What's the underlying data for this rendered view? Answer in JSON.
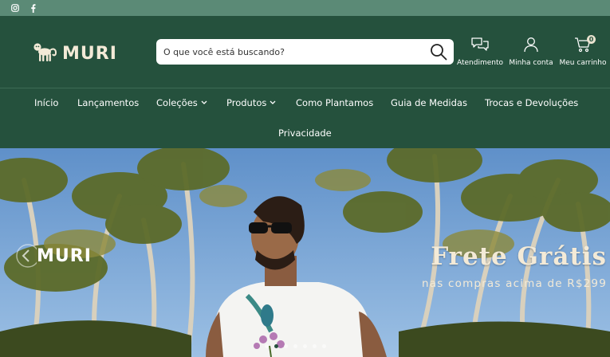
{
  "topbar": {
    "social": [
      {
        "icon": "instagram-icon"
      },
      {
        "icon": "facebook-icon"
      }
    ]
  },
  "header": {
    "logo_text": "MURI",
    "search": {
      "placeholder": "O que você está buscando?",
      "value": ""
    },
    "actions": [
      {
        "label": "Atendimento",
        "icon": "chat-icon"
      },
      {
        "label": "Minha conta",
        "icon": "user-icon"
      },
      {
        "label": "Meu carrinho",
        "icon": "cart-icon",
        "badge": "0"
      }
    ]
  },
  "nav": {
    "items": [
      {
        "label": "Início"
      },
      {
        "label": "Lançamentos"
      },
      {
        "label": "Coleções"
      },
      {
        "label": "Produtos"
      },
      {
        "label": "Como Plantamos"
      },
      {
        "label": "Guia de Medidas"
      },
      {
        "label": "Trocas e Devoluções"
      },
      {
        "label": "Privacidade"
      }
    ]
  },
  "hero": {
    "brand": "MURI",
    "headline": "Frete Grátis",
    "subline": "nas compras acima de R$299",
    "slide_count": 7,
    "active_slide": 2
  },
  "colors": {
    "primary": "#25513d",
    "topbar": "#5b8a76",
    "cream": "#f3ead7"
  }
}
